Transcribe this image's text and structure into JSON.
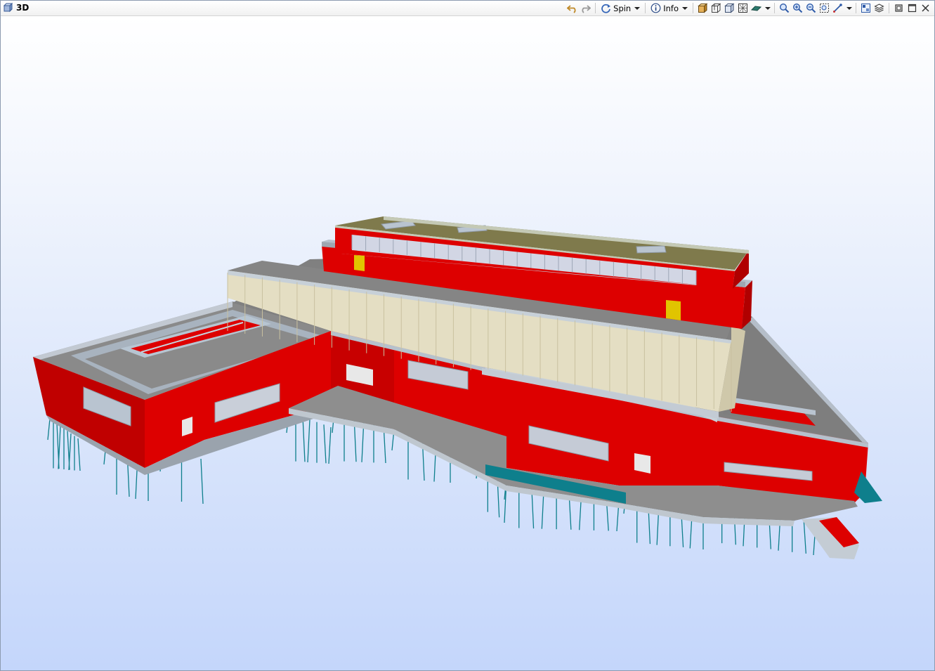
{
  "window": {
    "title": "3D"
  },
  "toolbar": {
    "spin_label": "Spin",
    "info_label": "Info"
  },
  "icons": {
    "title": "3d-view-icon",
    "undo": "undo-icon",
    "redo": "redo-icon",
    "spin": "spin-icon",
    "info": "info-icon",
    "view_shaded": "shaded-view-icon",
    "view_wire": "wireframe-view-icon",
    "view_hidden": "hidden-line-icon",
    "view_xray": "xray-view-icon",
    "surface": "surface-icon",
    "zoom_window": "zoom-window-icon",
    "zoom_in": "zoom-in-icon",
    "zoom_out": "zoom-out-icon",
    "zoom_fit": "zoom-extents-icon",
    "measure": "measure-icon",
    "properties": "properties-icon",
    "layers": "layers-icon",
    "restore": "restore-window-icon",
    "maximize": "maximize-icon",
    "close": "close-icon"
  },
  "colors": {
    "wall": "#dd0000",
    "roof": "#7d7d7d",
    "cladding": "#e4dec3",
    "piles": "#0e7f8c",
    "green_roof": "#7f7a4c"
  }
}
